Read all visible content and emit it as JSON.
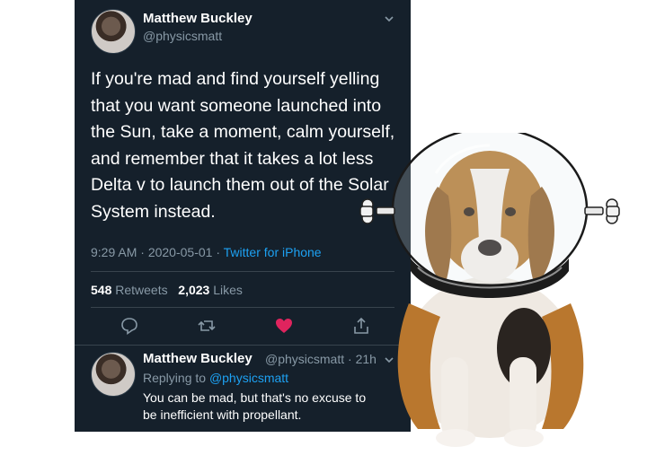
{
  "tweet": {
    "author_name": "Matthew Buckley",
    "author_handle": "@physicsmatt",
    "text": "If you're mad and find yourself yelling\nthat you want someone launched into\nthe Sun, take a moment, calm yourself,\nand remember that it takes a lot less\nDelta v to launch them out of the Solar\nSystem instead.",
    "time": "9:29 AM",
    "date": "2020-05-01",
    "separator": "·",
    "source": "Twitter for iPhone",
    "retweets_count": "548",
    "retweets_label": "Retweets",
    "likes_count": "2,023",
    "likes_label": "Likes",
    "actions": [
      "reply-icon",
      "retweet-icon",
      "heart-icon",
      "share-icon"
    ],
    "like_color": "#e0245e"
  },
  "reply": {
    "author_name": "Matthew Buckley",
    "author_handle": "@physicsmatt",
    "separator": "·",
    "age": "21h",
    "replying_prefix": "Replying to",
    "replying_to": "@physicsmatt",
    "text": "You can be mad, but that's no excuse to\nbe inefficient with propellant."
  },
  "colors": {
    "background": "#15202b",
    "text": "#ffffff",
    "secondary_text": "#8899a6",
    "link": "#1da1f2",
    "divider": "#38444d"
  },
  "image": {
    "subject": "beagle-in-space-helmet"
  }
}
